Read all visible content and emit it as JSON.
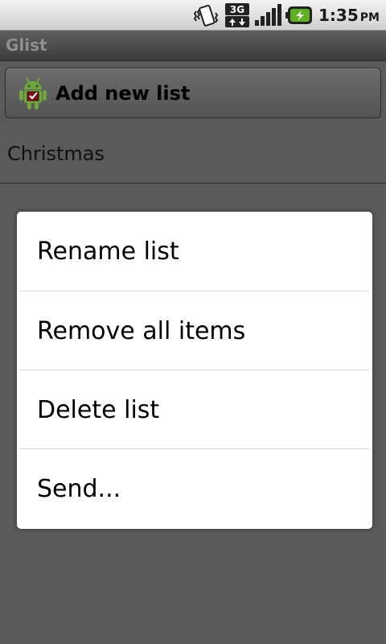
{
  "status_bar": {
    "time": "1:35",
    "ampm": "PM",
    "icons": [
      "vibrate-icon",
      "3g-data-icon",
      "signal-strength-icon",
      "battery-charging-icon"
    ],
    "network_label": "3G"
  },
  "app": {
    "title": "Glist"
  },
  "main": {
    "add_button_label": "Add new list",
    "add_button_icon": "android-robot-icon",
    "lists": [
      {
        "label": "Christmas"
      }
    ]
  },
  "context_menu": {
    "items": [
      {
        "label": "Rename list"
      },
      {
        "label": "Remove all items"
      },
      {
        "label": "Delete list"
      },
      {
        "label": "Send..."
      }
    ]
  },
  "colors": {
    "background": "#5a5a5a",
    "menu_background": "#ffffff",
    "robot_green": "#6fa83a",
    "battery_green": "#5fb020"
  }
}
